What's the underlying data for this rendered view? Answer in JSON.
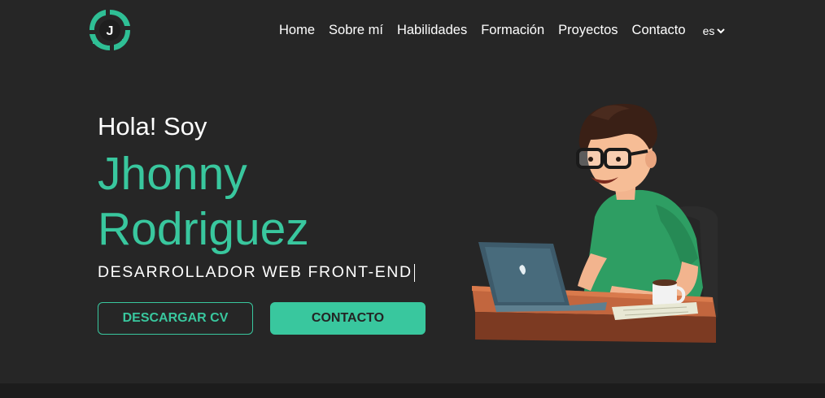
{
  "logo": {
    "letter": "J"
  },
  "nav": {
    "items": [
      "Home",
      "Sobre mí",
      "Habilidades",
      "Formación",
      "Proyectos",
      "Contacto"
    ],
    "language": "es"
  },
  "hero": {
    "greeting": "Hola! Soy",
    "first_name": "Jhonny",
    "last_name": "Rodriguez",
    "role": "DESARROLLADOR WEB FRONT-END"
  },
  "buttons": {
    "download_cv": "DESCARGAR CV",
    "contact": "CONTACTO"
  },
  "colors": {
    "accent": "#39c79e",
    "background": "#262626",
    "footer": "#1c1c1c"
  }
}
